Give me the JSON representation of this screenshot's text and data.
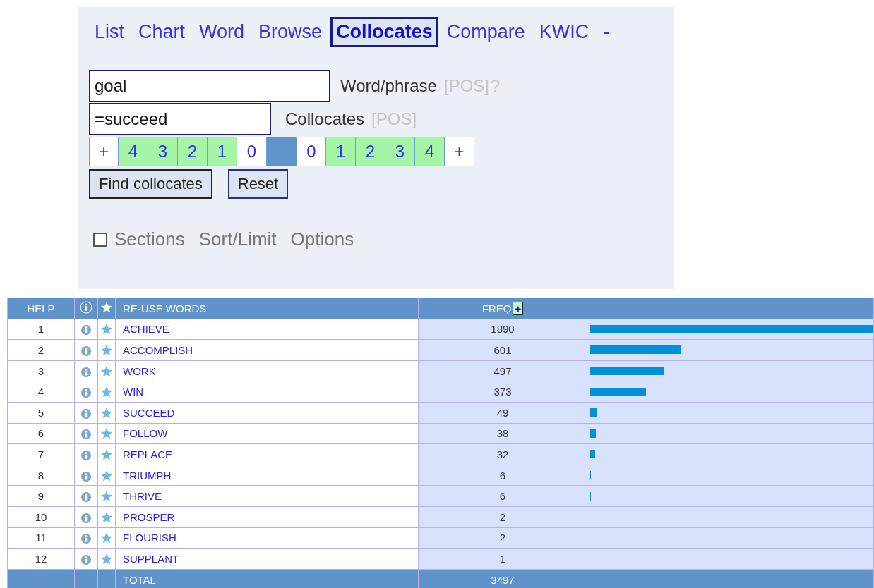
{
  "nav": [
    {
      "label": "List",
      "selected": false
    },
    {
      "label": "Chart",
      "selected": false
    },
    {
      "label": "Word",
      "selected": false
    },
    {
      "label": "Browse",
      "selected": false
    },
    {
      "label": "Collocates",
      "selected": true
    },
    {
      "label": "Compare",
      "selected": false
    },
    {
      "label": "KWIC",
      "selected": false
    },
    {
      "label": "-",
      "selected": false
    }
  ],
  "word_field": {
    "value": "goal",
    "label": "Word/phrase",
    "pos": "[POS]",
    "help": "?"
  },
  "collocates_field": {
    "value": "=succeed",
    "label": "Collocates",
    "pos": "[POS]"
  },
  "span_left": [
    {
      "label": "+",
      "selected": false
    },
    {
      "label": "4",
      "selected": true
    },
    {
      "label": "3",
      "selected": true
    },
    {
      "label": "2",
      "selected": true
    },
    {
      "label": "1",
      "selected": true
    },
    {
      "label": "0",
      "selected": false
    }
  ],
  "span_right": [
    {
      "label": "0",
      "selected": false
    },
    {
      "label": "1",
      "selected": true
    },
    {
      "label": "2",
      "selected": true
    },
    {
      "label": "3",
      "selected": true
    },
    {
      "label": "4",
      "selected": true
    },
    {
      "label": "+",
      "selected": false
    }
  ],
  "buttons": [
    "Find collocates",
    "Reset"
  ],
  "options": {
    "sections_checked": false,
    "sections": "Sections",
    "sort": "Sort/Limit",
    "options": "Options"
  },
  "table": {
    "columns": {
      "help": "HELP",
      "word": "RE-USE WORDS",
      "freq": "FREQ",
      "freq_add": "+"
    },
    "rows": [
      {
        "rank": "1",
        "word": "ACHIEVE",
        "freq": "1890",
        "level": 1
      },
      {
        "rank": "2",
        "word": "ACCOMPLISH",
        "freq": "601",
        "level": 0.318
      },
      {
        "rank": "3",
        "word": "WORK",
        "freq": "497",
        "level": 0.263
      },
      {
        "rank": "4",
        "word": "WIN",
        "freq": "373",
        "level": 0.197
      },
      {
        "rank": "5",
        "word": "SUCCEED",
        "freq": "49",
        "level": 0.026
      },
      {
        "rank": "6",
        "word": "FOLLOW",
        "freq": "38",
        "level": 0.02
      },
      {
        "rank": "7",
        "word": "REPLACE",
        "freq": "32",
        "level": 0.017
      },
      {
        "rank": "8",
        "word": "TRIUMPH",
        "freq": "6",
        "level": 0.003
      },
      {
        "rank": "9",
        "word": "THRIVE",
        "freq": "6",
        "level": 0.003
      },
      {
        "rank": "10",
        "word": "PROSPER",
        "freq": "2"
      },
      {
        "rank": "11",
        "word": "FLOURISH",
        "freq": "2"
      },
      {
        "rank": "12",
        "word": "SUPPLANT",
        "freq": "1"
      }
    ],
    "total": {
      "label": "TOTAL",
      "freq": "3497"
    }
  }
}
